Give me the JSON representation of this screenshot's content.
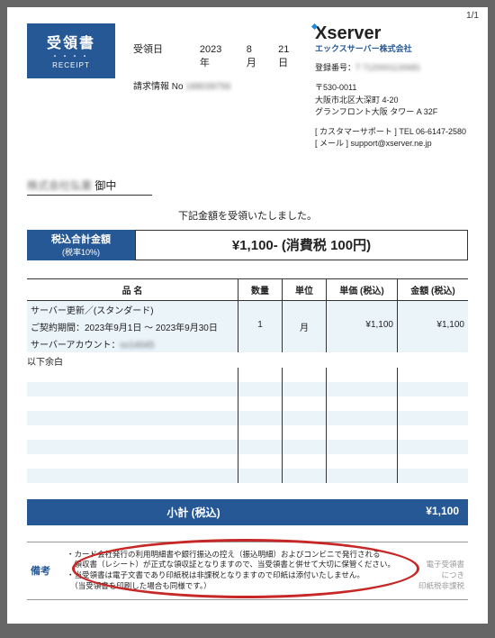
{
  "pageno": "1/1",
  "tag": {
    "jp": "受領書",
    "en": "RECEIPT"
  },
  "date": {
    "label": "受領日",
    "year": "2023年",
    "month": "8月",
    "day": "21日"
  },
  "billno": {
    "label": "請求情報 No",
    "value": "188039756"
  },
  "company": {
    "logo": "server",
    "logo_sub": "エックスサーバー株式会社",
    "reg_label": "登録番号",
    "reg_value": "T 7120001130681",
    "zip": "〒530-0011",
    "addr1": "大阪市北区大深町 4-20",
    "addr2": "グランフロント大阪 タワー A 32F",
    "support1": "[ カスタマーサポート ] TEL 06-6147-2580",
    "support2": "[ メール ] support@xserver.ne.jp"
  },
  "addressee": {
    "name": "株式会社弘業",
    "suffix": "御中"
  },
  "receipt_msg": "下記金額を受領いたしました。",
  "total": {
    "l1": "税込合計金額",
    "l2": "(税率10%)",
    "amount": "¥1,100- (消費税 100円)"
  },
  "columns": {
    "name": "品 名",
    "qty": "数量",
    "unit": "単位",
    "price": "単価 (税込)",
    "amount": "金額 (税込)"
  },
  "rows": [
    {
      "name": "サーバー更新／(スタンダード)",
      "qty": "",
      "unit": "",
      "price": "",
      "amount": ""
    },
    {
      "name": "ご契約期間：2023年9月1日 ～ 2023年9月30日",
      "qty": "1",
      "unit": "月",
      "price": "¥1,100",
      "amount": "¥1,100"
    },
    {
      "name_prefix": "サーバーアカウント：",
      "name_blur": "sv14045",
      "qty": "",
      "unit": "",
      "price": "",
      "amount": ""
    }
  ],
  "below": "以下余白",
  "subtotal": {
    "label": "小計 (税込)",
    "value": "¥1,100"
  },
  "notes": {
    "label": "備考",
    "l1": "・カード会社発行の利用明細書や銀行振込の控え（振込明細）およびコンビニで発行される",
    "l2": "　領収書（レシート）が正式な領収証となりますので、当受領書と併せて大切に保管ください。",
    "l3": "・当受領書は電子文書であり印紙税は非課税となりますので印紙は添付いたしません。",
    "l4": "　（当受領書を印刷した場合も同様です。）",
    "r1": "電子受領書",
    "r2": "につき",
    "r3": "印紙税非課税"
  }
}
